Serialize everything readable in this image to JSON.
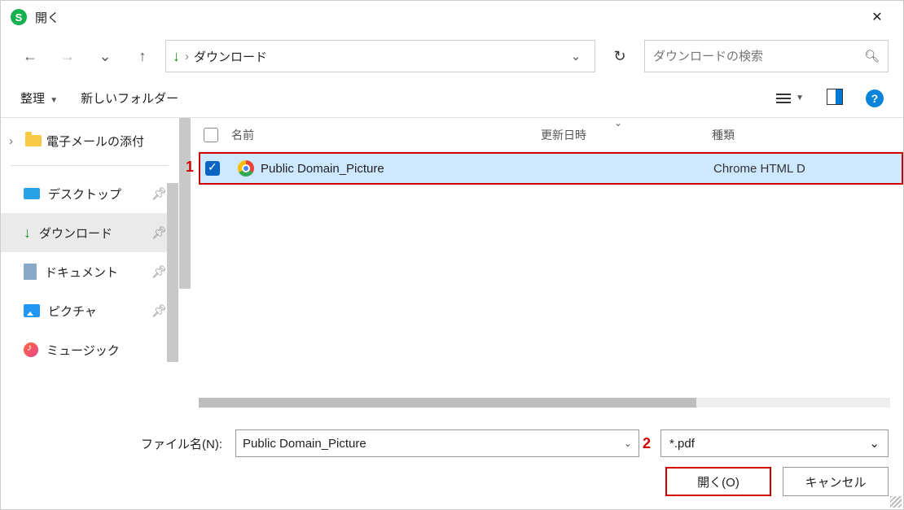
{
  "title": "開く",
  "address": {
    "location": "ダウンロード"
  },
  "search": {
    "placeholder": "ダウンロードの検索"
  },
  "toolbar": {
    "organize": "整理",
    "new_folder": "新しいフォルダー"
  },
  "tree": {
    "email_attach": "電子メールの添付",
    "items": [
      {
        "label": "デスクトップ"
      },
      {
        "label": "ダウンロード"
      },
      {
        "label": "ドキュメント"
      },
      {
        "label": "ピクチャ"
      },
      {
        "label": "ミュージック"
      }
    ]
  },
  "columns": {
    "name": "名前",
    "date": "更新日時",
    "type": "種類"
  },
  "files": [
    {
      "name": "Public Domain_Picture",
      "date": "",
      "type": "Chrome HTML D"
    }
  ],
  "callouts": {
    "one": "1",
    "two": "2"
  },
  "footer": {
    "filename_label": "ファイル名(N):",
    "filename_value": "Public Domain_Picture",
    "filter": "*.pdf",
    "open": "開く(O)",
    "cancel": "キャンセル"
  }
}
